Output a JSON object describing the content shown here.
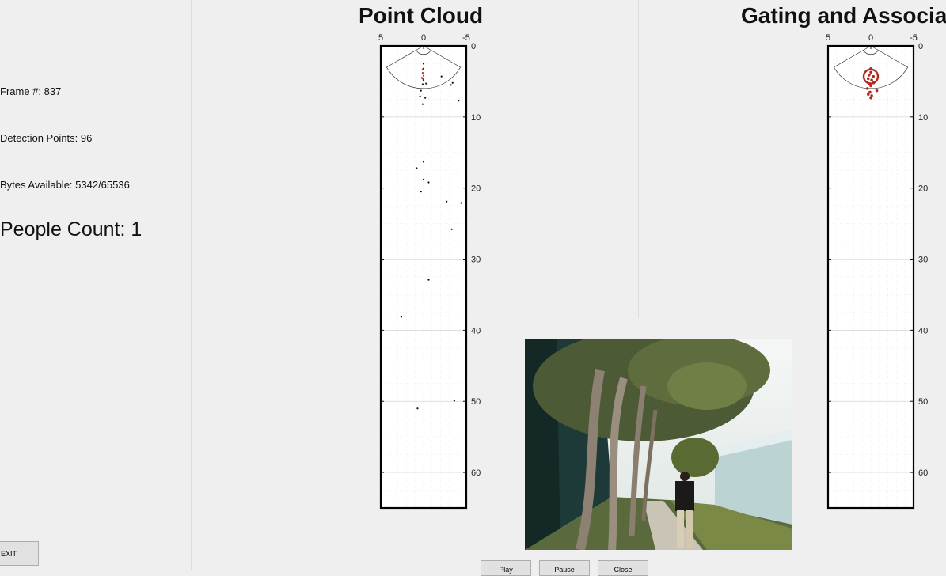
{
  "info": {
    "frame": "Frame #: 837",
    "detection_points": "Detection Points: 96",
    "bytes_available": "Bytes Available: 5342/65536",
    "people_count": "People Count: 1"
  },
  "controls": {
    "exit_label": "EXIT",
    "play_label": "Play",
    "pause_label": "Pause",
    "close_label": "Close"
  },
  "panels": {
    "point_cloud": {
      "title": "Point Cloud"
    },
    "gating": {
      "title": "Gating and Associa"
    }
  },
  "colors": {
    "points": "#111111",
    "cluster": "#b22a1e",
    "background": "#efefef"
  },
  "chart_data": [
    {
      "type": "scatter",
      "title": "Point Cloud",
      "xlim": [
        5,
        -5
      ],
      "ylim": [
        0,
        65
      ],
      "x_ticks": [
        "5",
        "0",
        "-5"
      ],
      "y_ticks": [
        "0",
        "10",
        "20",
        "30",
        "40",
        "50",
        "60"
      ],
      "grid": true,
      "series": [
        {
          "color": "#111111",
          "points": [
            [
              0,
              2.5
            ],
            [
              0,
              3.2
            ],
            [
              0.2,
              4.5
            ],
            [
              0,
              4.8
            ],
            [
              0.1,
              5.4
            ],
            [
              -0.3,
              5.3
            ],
            [
              0.3,
              6.3
            ],
            [
              0.4,
              7.1
            ],
            [
              -0.2,
              7.3
            ],
            [
              0.1,
              8.2
            ],
            [
              -2.1,
              4.3
            ],
            [
              -3.2,
              5.5
            ],
            [
              -3.4,
              5.2
            ],
            [
              -4.1,
              7.7
            ],
            [
              0,
              16.3
            ],
            [
              0.8,
              17.2
            ],
            [
              0,
              18.8
            ],
            [
              -0.6,
              19.2
            ],
            [
              0.3,
              20.5
            ],
            [
              -2.7,
              21.9
            ],
            [
              -4.4,
              22.1
            ],
            [
              5.4,
              24.0
            ],
            [
              -3.3,
              25.8
            ],
            [
              -0.6,
              32.9
            ],
            [
              2.6,
              38.1
            ],
            [
              5.3,
              43.3
            ],
            [
              -3.6,
              49.9
            ],
            [
              0.7,
              51.0
            ],
            [
              5.8,
              37.3
            ]
          ]
        },
        {
          "color": "#b22a1e",
          "points": [
            [
              0.1,
              3.3
            ],
            [
              0.1,
              3.8
            ],
            [
              0,
              4.2
            ],
            [
              0.1,
              4.6
            ]
          ]
        }
      ]
    },
    {
      "type": "scatter",
      "title": "Gating and Associa",
      "xlim": [
        5,
        -5
      ],
      "ylim": [
        0,
        65
      ],
      "x_ticks": [
        "5",
        "0",
        "-5"
      ],
      "y_ticks": [
        "0",
        "10",
        "20",
        "30",
        "40",
        "50",
        "60"
      ],
      "grid": true,
      "series": [
        {
          "color": "#b22a1e",
          "points": [
            [
              0,
              3.2
            ],
            [
              0,
              3.7
            ],
            [
              0.2,
              4.1
            ],
            [
              -0.3,
              4.3
            ],
            [
              0.3,
              4.6
            ],
            [
              -0.1,
              4.8
            ],
            [
              0.2,
              5.3
            ],
            [
              -0.3,
              5.2
            ],
            [
              0,
              5.6
            ],
            [
              0.4,
              6.0
            ],
            [
              -0.7,
              6.3
            ],
            [
              0.1,
              6.5
            ],
            [
              0.3,
              6.8
            ],
            [
              -0.1,
              7.0
            ],
            [
              0,
              7.3
            ]
          ]
        }
      ],
      "track": {
        "x": 0,
        "y": 4.3,
        "radius": 1.0
      }
    }
  ]
}
